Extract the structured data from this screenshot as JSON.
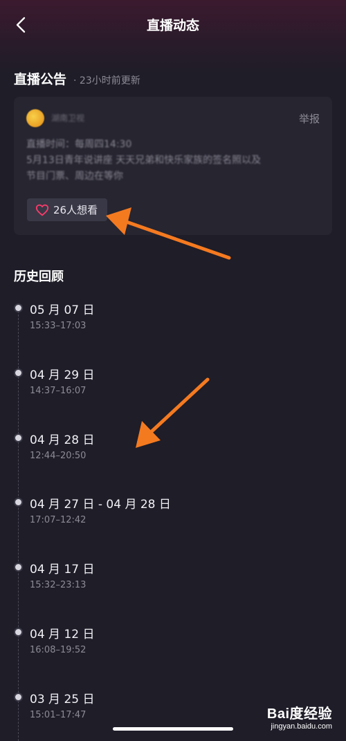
{
  "nav": {
    "title": "直播动态"
  },
  "announcement": {
    "section_title": "直播公告",
    "updated": "· 23小时前更新",
    "account_name": "湖南卫视",
    "report_label": "举报",
    "body_lines": [
      "直播时间：每周四14:30",
      "5月13日青年说讲座 天天兄弟和快乐家族的签名照以及",
      "节目门票、周边在等你"
    ],
    "want_label": "26人想看"
  },
  "history": {
    "title": "历史回顾",
    "items": [
      {
        "date": "05 月 07 日",
        "time": "15:33–17:03"
      },
      {
        "date": "04 月 29 日",
        "time": "14:37–16:07"
      },
      {
        "date": "04 月 28 日",
        "time": "12:44–20:50"
      },
      {
        "date": "04 月 27 日 - 04 月 28 日",
        "time": "17:07–12:42"
      },
      {
        "date": "04 月 17 日",
        "time": "15:32–23:13"
      },
      {
        "date": "04 月 12 日",
        "time": "16:08–19:52"
      },
      {
        "date": "03 月 25 日",
        "time": "15:01–17:47"
      }
    ]
  },
  "watermark": {
    "brand": "Bai度经验",
    "url": "jingyan.baidu.com"
  },
  "colors": {
    "background": "#1e1d28",
    "card": "#262530",
    "arrow": "#f47a20",
    "heart": "#ff3b6b"
  },
  "icons": [
    "back-arrow-icon",
    "heart-icon",
    "paw-icon"
  ]
}
